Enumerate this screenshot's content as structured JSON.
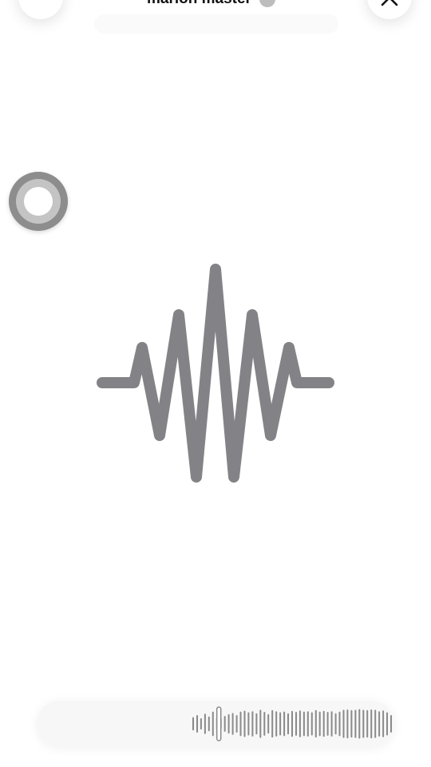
{
  "header": {
    "title": "marion master"
  },
  "icons": {
    "menu": "list-icon",
    "close": "close-icon",
    "badge": "verified-badge-icon",
    "assistive": "assistive-touch-icon",
    "voice": "voice-waveform-icon"
  },
  "colors": {
    "waveform": "#838387",
    "ring_outer": "#8d8d8d",
    "ring_inner": "#c4c4c4",
    "pill_background": "#f7f7f7",
    "bars": "#8a8a8a"
  },
  "recording": {
    "bar_levels": [
      0.38,
      0.5,
      0.32,
      0.58,
      0.42,
      0.7,
      0.35,
      0.3,
      0.45,
      0.55,
      0.62,
      0.5,
      0.7,
      0.75,
      0.66,
      0.72,
      0.6,
      0.8,
      0.68,
      0.55,
      0.78,
      0.72,
      0.66,
      0.7,
      0.6,
      0.74,
      0.68,
      0.76,
      0.7,
      0.72,
      0.66,
      0.78,
      0.7,
      0.74,
      0.68,
      0.72,
      0.6,
      0.7,
      0.8,
      0.82,
      0.78,
      0.8,
      0.84,
      0.8,
      0.78,
      0.82,
      0.8,
      0.72,
      0.76,
      0.66,
      0.5
    ],
    "playhead_position": 0.13
  }
}
